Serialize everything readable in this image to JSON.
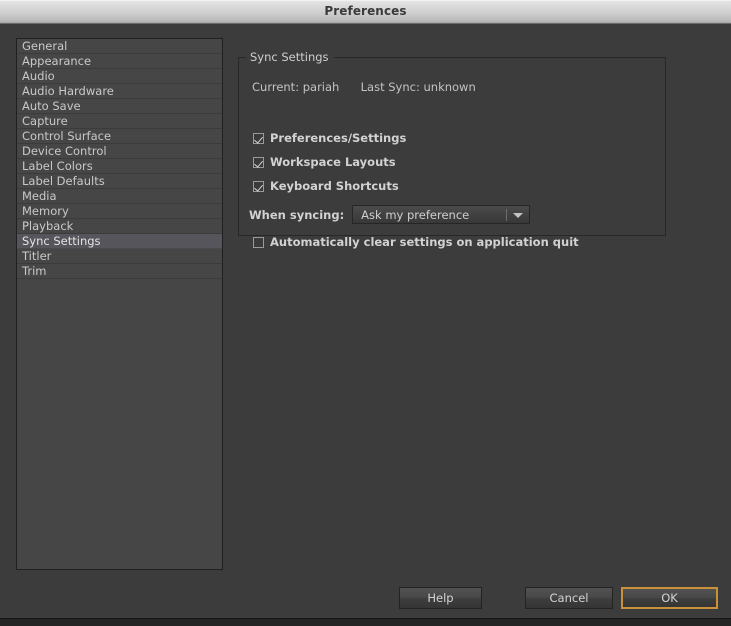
{
  "window": {
    "title": "Preferences"
  },
  "sidebar": {
    "items": [
      {
        "label": "General",
        "selected": false
      },
      {
        "label": "Appearance",
        "selected": false
      },
      {
        "label": "Audio",
        "selected": false
      },
      {
        "label": "Audio Hardware",
        "selected": false
      },
      {
        "label": "Auto Save",
        "selected": false
      },
      {
        "label": "Capture",
        "selected": false
      },
      {
        "label": "Control Surface",
        "selected": false
      },
      {
        "label": "Device Control",
        "selected": false
      },
      {
        "label": "Label Colors",
        "selected": false
      },
      {
        "label": "Label Defaults",
        "selected": false
      },
      {
        "label": "Media",
        "selected": false
      },
      {
        "label": "Memory",
        "selected": false
      },
      {
        "label": "Playback",
        "selected": false
      },
      {
        "label": "Sync Settings",
        "selected": true
      },
      {
        "label": "Titler",
        "selected": false
      },
      {
        "label": "Trim",
        "selected": false
      }
    ]
  },
  "main": {
    "group_title": "Sync Settings",
    "status": {
      "current_label": "Current: pariah",
      "last_sync_label": "Last Sync: unknown"
    },
    "checkboxes": [
      {
        "label": "Preferences/Settings",
        "checked": true
      },
      {
        "label": "Workspace Layouts",
        "checked": true
      },
      {
        "label": "Keyboard Shortcuts",
        "checked": true
      }
    ],
    "when_syncing": {
      "label": "When syncing:",
      "value": "Ask my preference",
      "arrow_icon": "chevron-down-icon"
    },
    "auto_clear": {
      "label": "Automatically clear settings on application quit",
      "checked": false
    }
  },
  "footer": {
    "help_label": "Help",
    "cancel_label": "Cancel",
    "ok_label": "OK",
    "focused_button": "OK"
  },
  "colors": {
    "dialog_background": "#3c3c3c",
    "list_background": "#464646",
    "list_selected": "#55555b",
    "text_primary": "#d2d2d2",
    "text_secondary": "#c3c3c3",
    "focus_accent": "#c8913a",
    "titlebar_text": "#3b3b3b"
  }
}
